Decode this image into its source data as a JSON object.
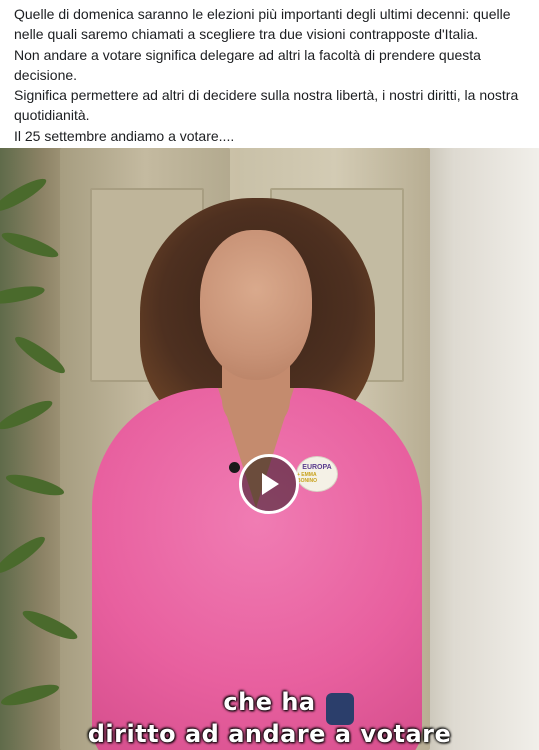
{
  "post": {
    "paragraphs": [
      "Quelle di domenica saranno le elezioni più importanti degli ultimi decenni: quelle nelle quali saremo chiamati a scegliere tra due visioni contrapposte d'Italia.",
      "Non andare a votare significa delegare ad altri la facoltà di prendere questa decisione.",
      "Significa permettere ad altri di decidere sulla nostra libertà, i nostri diritti, la nostra quotidianità.",
      "Il 25 settembre andiamo a votare...."
    ]
  },
  "video": {
    "badge": {
      "line1": "EUROPA",
      "line2": "+ EMMA BONINO"
    },
    "caption": {
      "line1": "che ha",
      "line2": "diritto ad andare a votare"
    },
    "play_icon": "play-icon"
  },
  "colors": {
    "shirt": "#e8609f",
    "text": "#1c1e21",
    "caption": "#ffffff"
  }
}
